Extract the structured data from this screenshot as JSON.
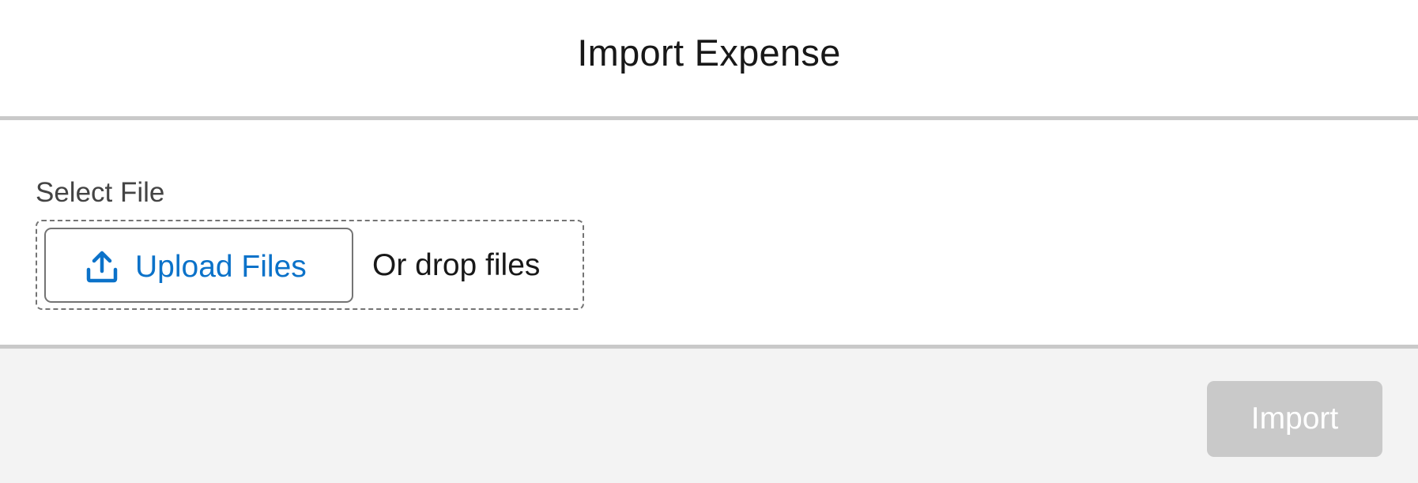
{
  "modal": {
    "title": "Import Expense"
  },
  "form": {
    "select_file_label": "Select File",
    "upload_button_label": "Upload Files",
    "upload_icon": "upload-icon",
    "drop_text": "Or drop files"
  },
  "footer": {
    "import_button_label": "Import",
    "import_button_state": "disabled"
  },
  "colors": {
    "link_blue": "#0b72c9",
    "disabled_button": "#c9c9c9",
    "divider": "#c9c9c9",
    "footer_bg": "#f3f3f3"
  }
}
